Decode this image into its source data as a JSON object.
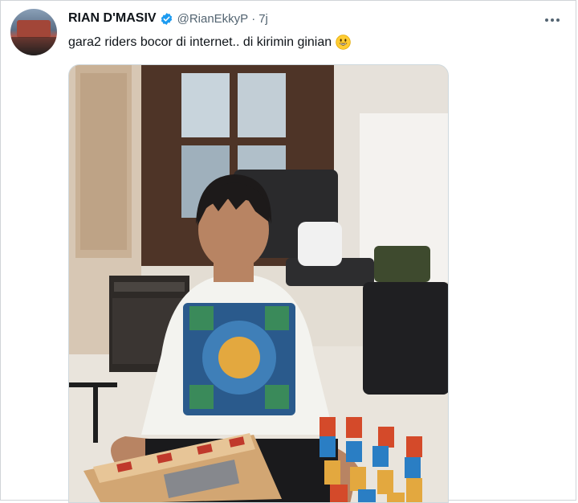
{
  "tweet": {
    "display_name": "RIAN D'MASIV",
    "handle": "@RianEkkyP",
    "separator": "·",
    "time": "7j",
    "text": "gara2 riders bocor di internet.. di kirimin ginian",
    "emoji": "grinning-face-emoji",
    "verified_icon": "verified-badge-icon",
    "more_icon": "more-options-icon"
  },
  "colors": {
    "verified": "#1d9bf0",
    "muted_text": "#536471",
    "text": "#0f1419"
  }
}
